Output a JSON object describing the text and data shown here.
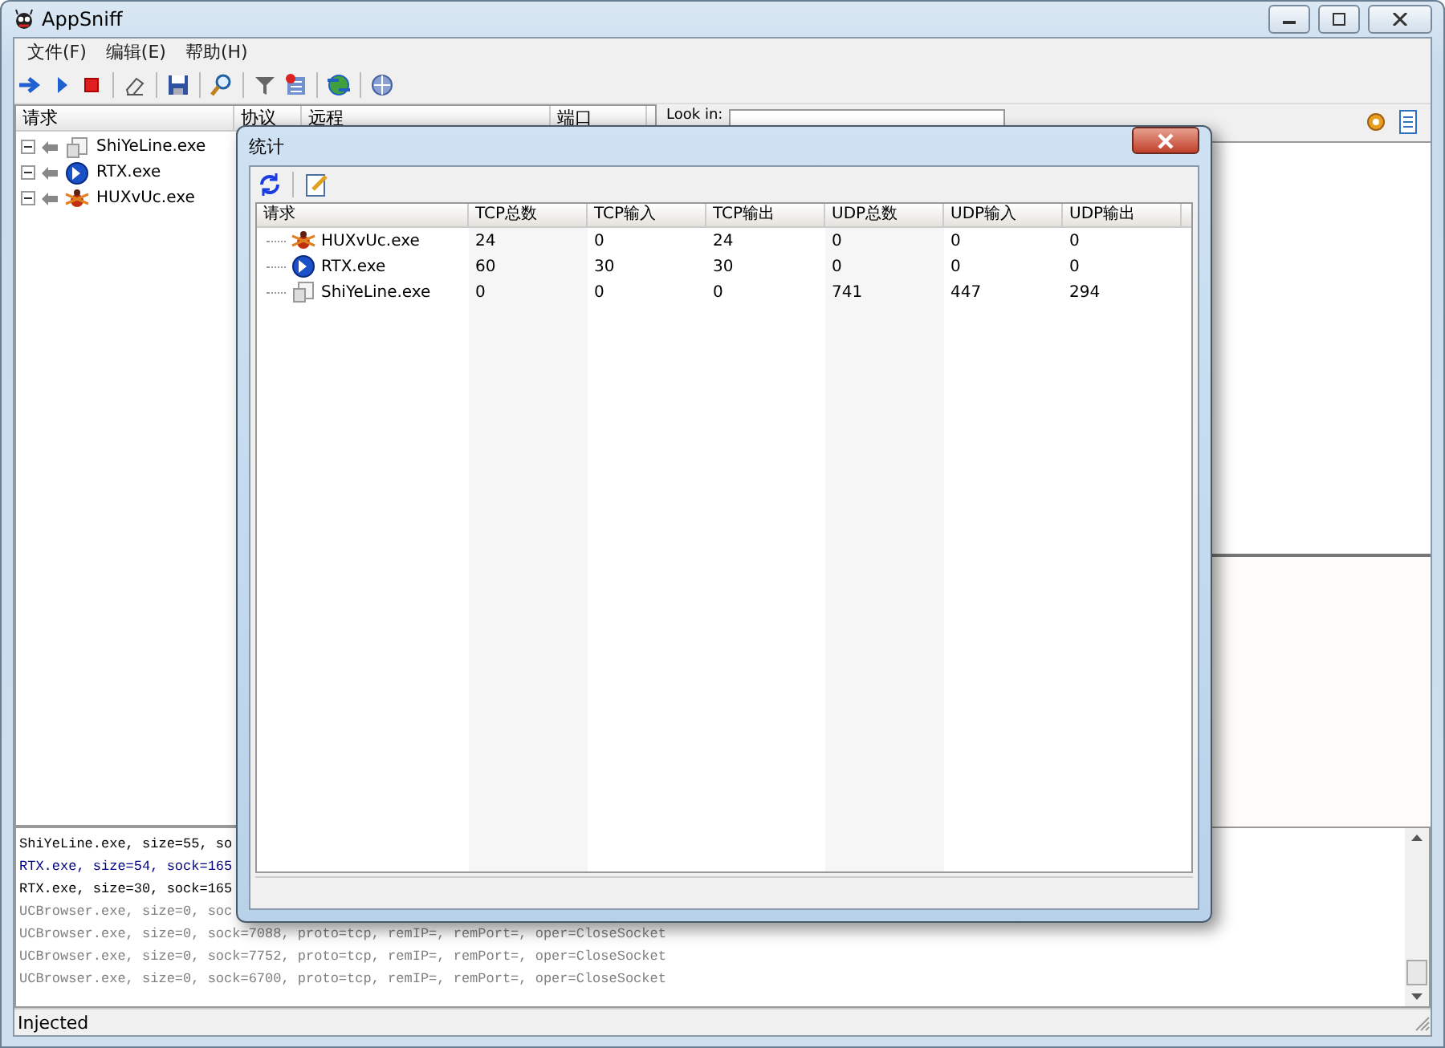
{
  "window": {
    "title": "AppSniff"
  },
  "menu": [
    {
      "label": "文件(F)"
    },
    {
      "label": "编辑(E)"
    },
    {
      "label": "帮助(H)"
    }
  ],
  "request_list": {
    "columns": [
      "请求",
      "协议",
      "远程",
      "端口"
    ],
    "items": [
      {
        "label": "ShiYeLine.exe",
        "expanded": true
      },
      {
        "label": "RTX.exe",
        "expanded": true
      },
      {
        "label": "HUXvUc.exe",
        "expanded": true
      }
    ]
  },
  "search": {
    "label": "Look in:"
  },
  "log": [
    {
      "text": "ShiYeLine.exe, size=55, so",
      "color": "#000000"
    },
    {
      "text": "RTX.exe, size=54, sock=165",
      "color": "#000080"
    },
    {
      "text": "RTX.exe, size=30, sock=165",
      "color": "#000000"
    },
    {
      "text": "UCBrowser.exe, size=0, soc",
      "color": "#808080"
    },
    {
      "text": "UCBrowser.exe, size=0, sock=7088, proto=tcp, remIP=, remPort=, oper=CloseSocket",
      "color": "#808080"
    },
    {
      "text": "UCBrowser.exe, size=0, sock=7752, proto=tcp, remIP=, remPort=, oper=CloseSocket",
      "color": "#808080"
    },
    {
      "text": "UCBrowser.exe, size=0, sock=6700, proto=tcp, remIP=, remPort=, oper=CloseSocket",
      "color": "#808080"
    }
  ],
  "status_bar": "Injected",
  "dialog": {
    "title": "统计",
    "columns": [
      "请求",
      "TCP总数",
      "TCP输入",
      "TCP输出",
      "UDP总数",
      "UDP输入",
      "UDP输出"
    ],
    "rows": [
      {
        "cells": [
          "HUXvUc.exe",
          "24",
          "0",
          "24",
          "0",
          "0",
          "0"
        ]
      },
      {
        "cells": [
          "RTX.exe",
          "60",
          "30",
          "30",
          "0",
          "0",
          "0"
        ]
      },
      {
        "cells": [
          "ShiYeLine.exe",
          "0",
          "0",
          "0",
          "741",
          "447",
          "294"
        ]
      }
    ]
  }
}
